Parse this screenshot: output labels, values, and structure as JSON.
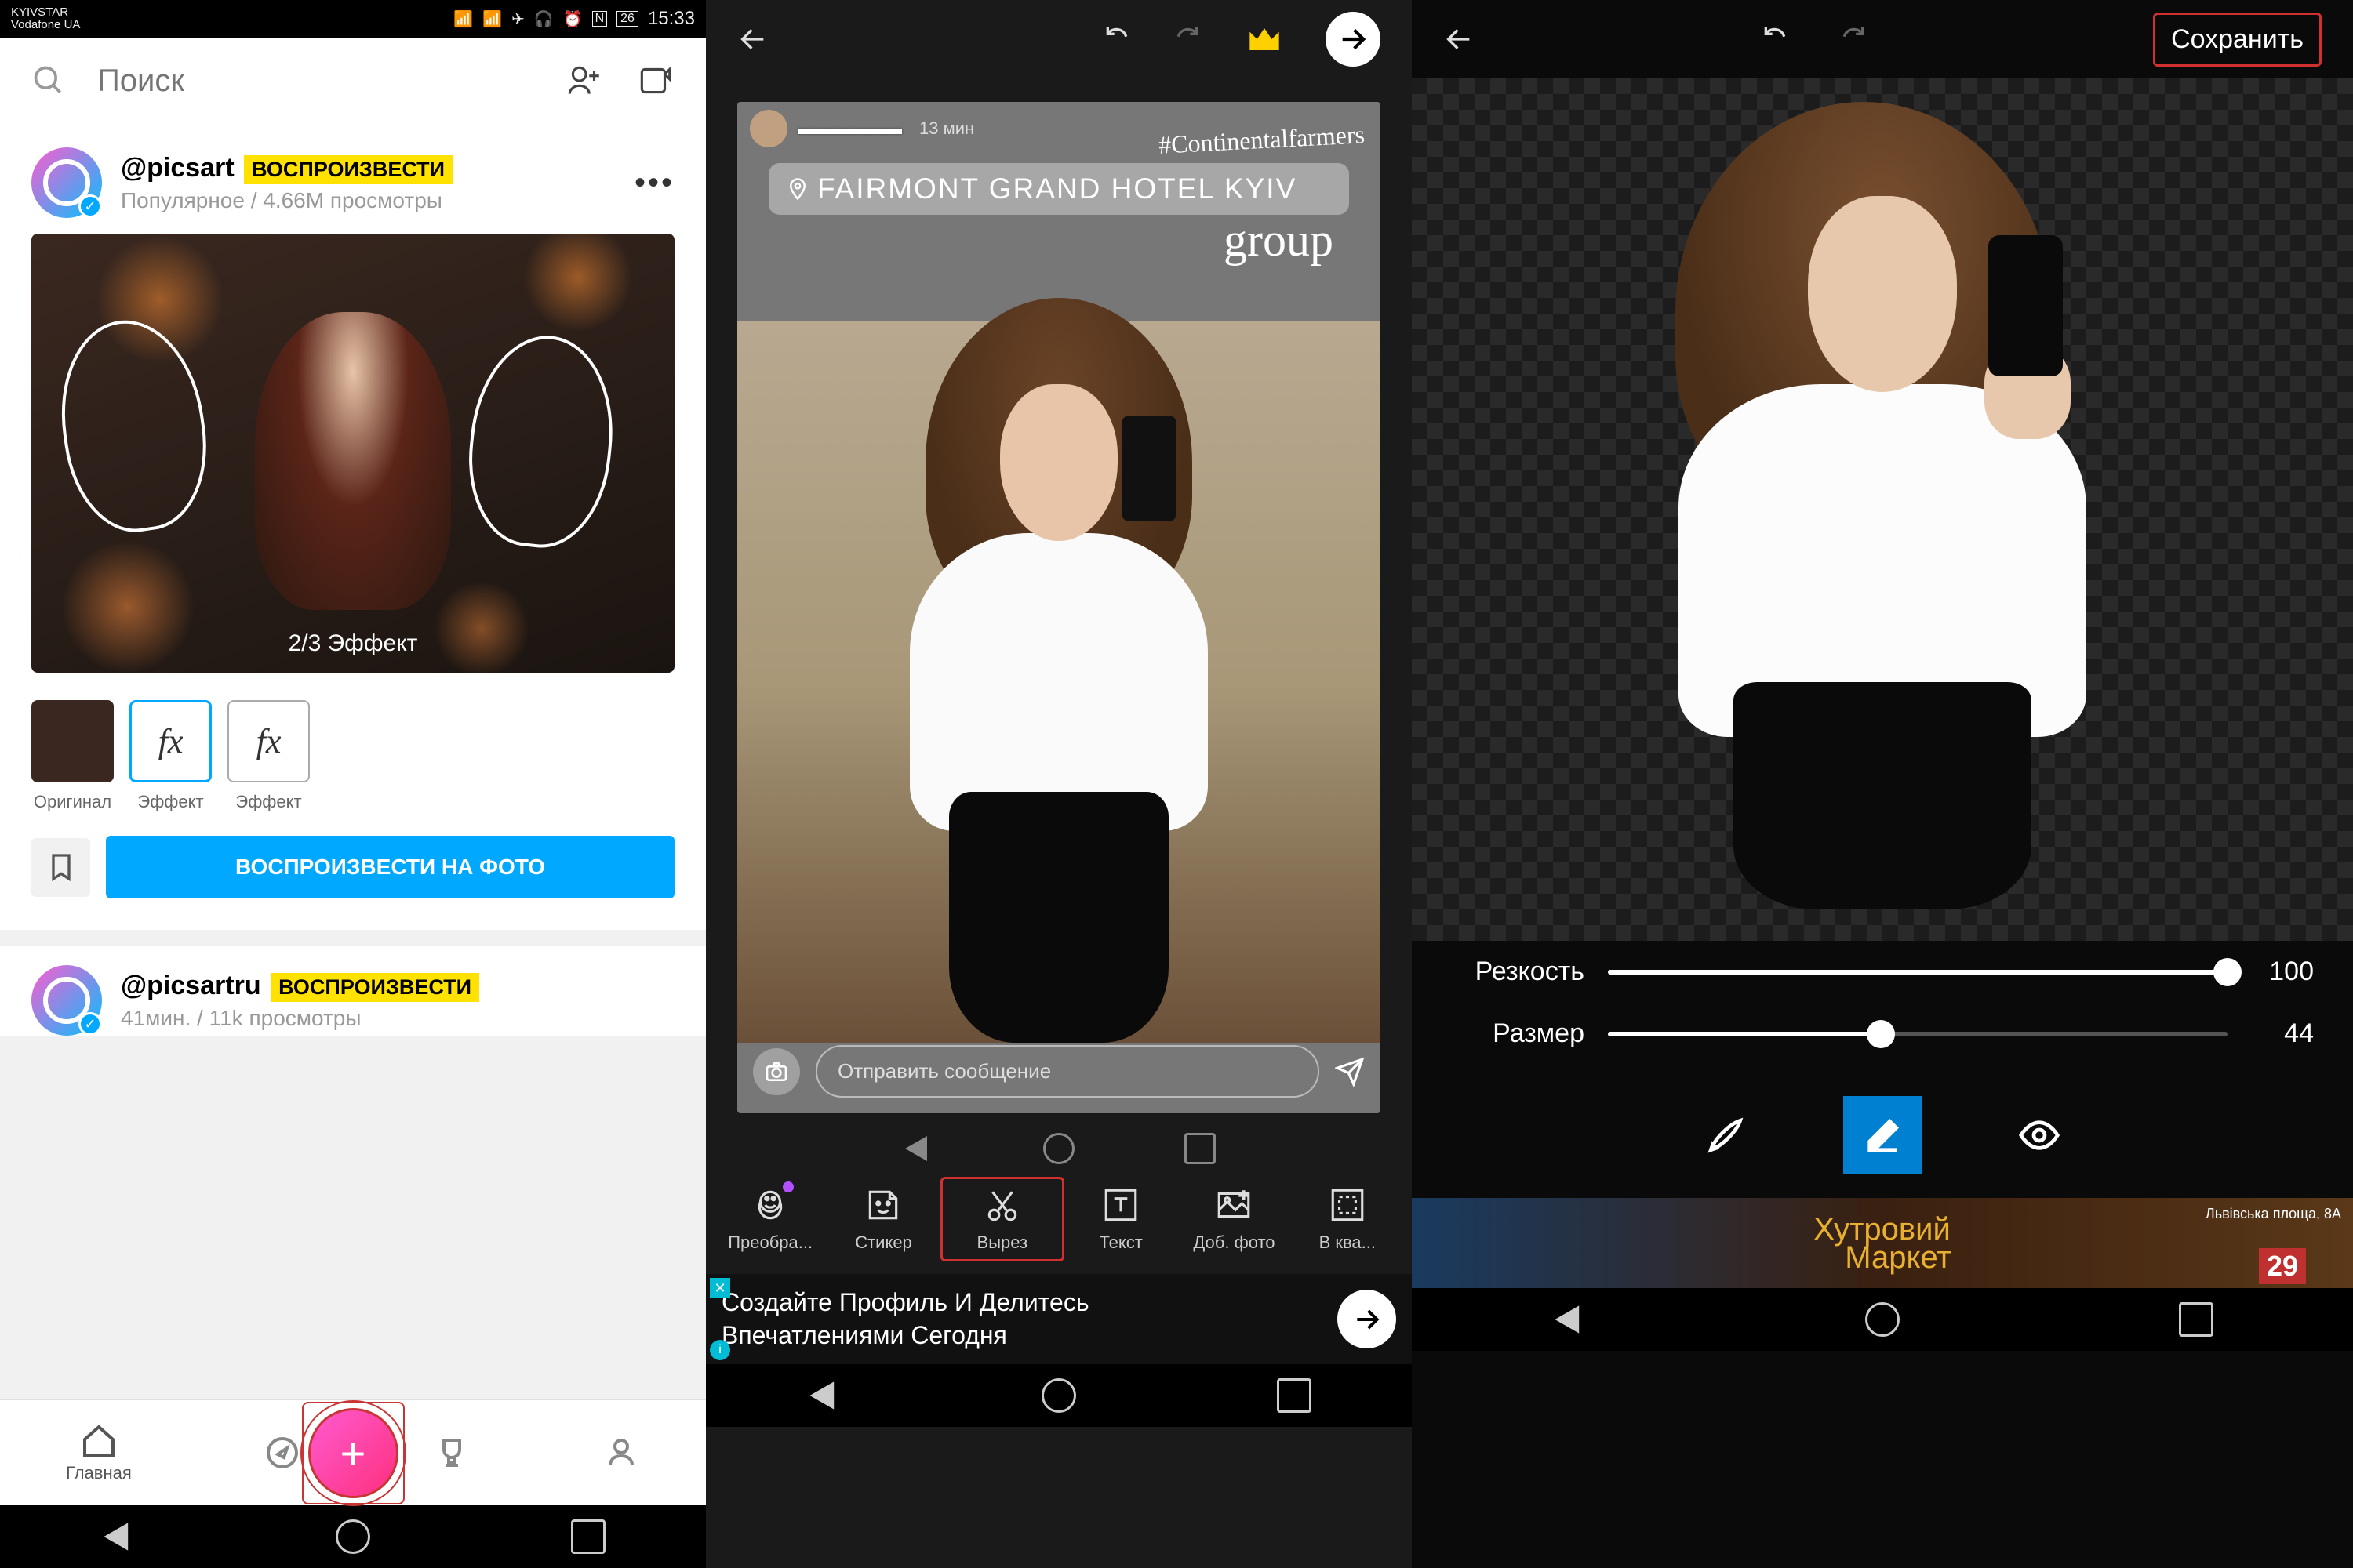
{
  "panel1": {
    "status": {
      "carrier1": "KYIVSTAR",
      "carrier2": "Vodafone UA",
      "battery": "26",
      "time": "15:33"
    },
    "search_placeholder": "Поиск",
    "post1": {
      "username": "@picsart",
      "badge": "ВОСПРОИЗВЕСТИ",
      "subtitle": "Популярное / 4.66M просмотры",
      "effect_label": "2/3 Эффект",
      "thumbs": [
        {
          "label": "Оригинал"
        },
        {
          "label": "Эффект",
          "fx": "fx"
        },
        {
          "label": "Эффект",
          "fx": "fx"
        }
      ],
      "play_button": "ВОСПРОИЗВЕСТИ НА ФОТО"
    },
    "post2": {
      "username": "@picsartru",
      "badge": "ВОСПРОИЗВЕСТИ",
      "subtitle": "41мин. / 11k просмотры"
    },
    "nav": {
      "home": "Главная"
    }
  },
  "panel2": {
    "story": {
      "time": "13 мин",
      "hashtag": "#Continentalfarmers",
      "location": "FAIRMONT GRAND HOTEL KYIV",
      "group": "group",
      "msg_placeholder": "Отправить сообщение"
    },
    "tools": [
      {
        "label": "Преобра..."
      },
      {
        "label": "Стикер"
      },
      {
        "label": "Вырез"
      },
      {
        "label": "Текст"
      },
      {
        "label": "Доб. фото"
      },
      {
        "label": "В ква..."
      }
    ],
    "ad": {
      "line1": "Создайте Профиль И Делитесь",
      "line2": "Впечатлениями Сегодня"
    }
  },
  "panel3": {
    "save_button": "Сохранить",
    "slider1": {
      "label": "Резкость",
      "value": "100",
      "percent": 100
    },
    "slider2": {
      "label": "Размер",
      "value": "44",
      "percent": 44
    },
    "ad": {
      "brand": "Хутровий",
      "brand2": "Маркет",
      "addr": "Львівська площа, 8А",
      "date": "29"
    }
  }
}
